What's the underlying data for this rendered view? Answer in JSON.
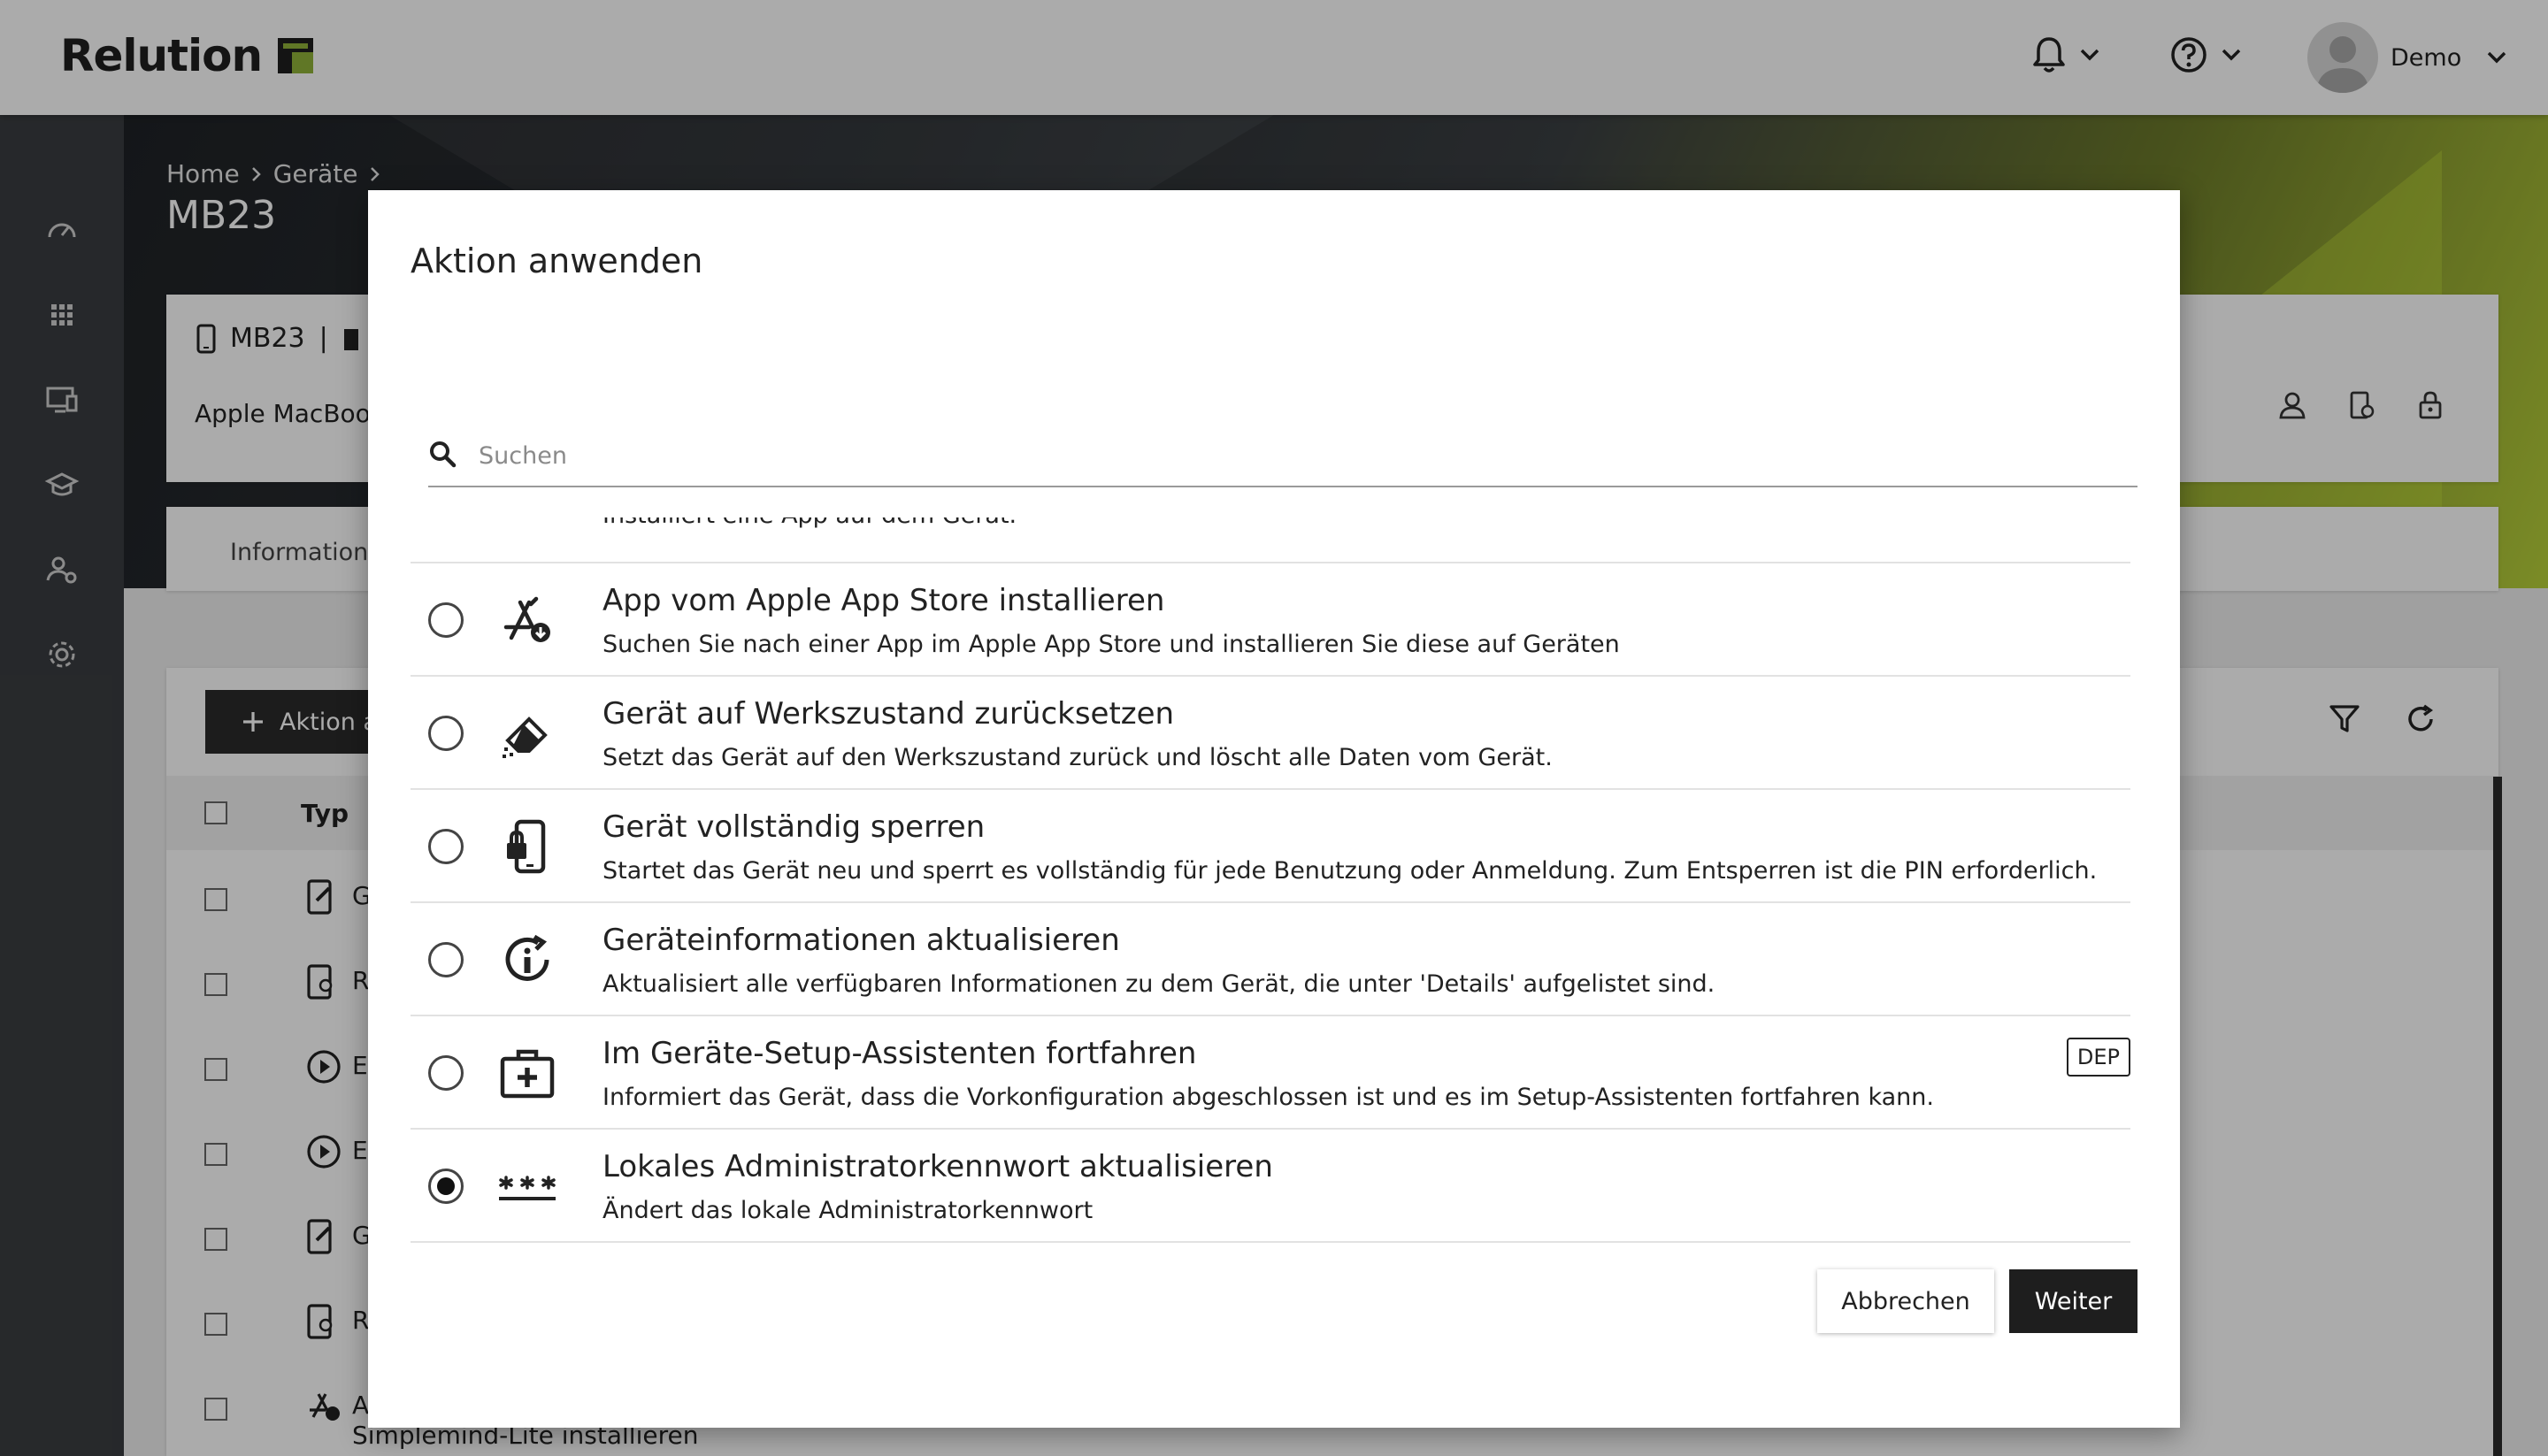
{
  "app": {
    "logo_text": "Relution",
    "brand_color": "#8fb23a",
    "user_name": "Demo"
  },
  "breadcrumb": [
    "Home",
    "Geräte"
  ],
  "page_title": "MB23",
  "device": {
    "name": "MB23",
    "separator": "|",
    "model": "Apple MacBook"
  },
  "tabs": [
    "Informatione"
  ],
  "table": {
    "add_button_label": "Aktion a",
    "type_header": "Typ",
    "rows": [
      {
        "icon": "edit-device-icon",
        "text": "G"
      },
      {
        "icon": "device-gear-icon",
        "text": "R"
      },
      {
        "icon": "play-circle-icon",
        "text": "E"
      },
      {
        "icon": "play-circle-icon",
        "text": "E"
      },
      {
        "icon": "edit-device-icon",
        "text": "G"
      },
      {
        "icon": "device-gear-icon",
        "text": "R"
      },
      {
        "icon": "app-store-install-icon",
        "text": "A"
      }
    ],
    "row_partial_text": "Simplemind-Lite installieren"
  },
  "modal": {
    "title": "Aktion anwenden",
    "search_placeholder": "Suchen",
    "clipped_item_desc": "Installiert eine App auf dem Gerät.",
    "items": [
      {
        "title": "App vom Apple App Store installieren",
        "desc": "Suchen Sie nach einer App im Apple App Store und installieren Sie diese auf Geräten",
        "icon": "app-store-install-icon",
        "selected": false
      },
      {
        "title": "Gerät auf Werkszustand zurücksetzen",
        "desc": "Setzt das Gerät auf den Werkszustand zurück und löscht alle Daten vom Gerät.",
        "icon": "eraser-icon",
        "selected": false
      },
      {
        "title": "Gerät vollständig sperren",
        "desc": "Startet das Gerät neu und sperrt es vollständig für jede Benutzung oder Anmeldung. Zum Entsperren ist die PIN erforderlich.",
        "icon": "device-lock-icon",
        "selected": false
      },
      {
        "title": "Geräteinformationen aktualisieren",
        "desc": "Aktualisiert alle verfügbaren Informationen zu dem Gerät, die unter 'Details' aufgelistet sind.",
        "icon": "info-refresh-icon",
        "selected": false
      },
      {
        "title": "Im Geräte-Setup-Assistenten fortfahren",
        "desc": "Informiert das Gerät, dass die Vorkonfiguration abgeschlossen ist und es im Setup-Assistenten fortfahren kann.",
        "icon": "first-aid-kit-icon",
        "badge": "DEP",
        "selected": false
      },
      {
        "title": "Lokales Administratorkennwort aktualisieren",
        "desc": "Ändert das lokale Administratorkennwort",
        "icon": "password-icon",
        "selected": true
      }
    ],
    "cancel_label": "Abbrechen",
    "next_label": "Weiter"
  }
}
